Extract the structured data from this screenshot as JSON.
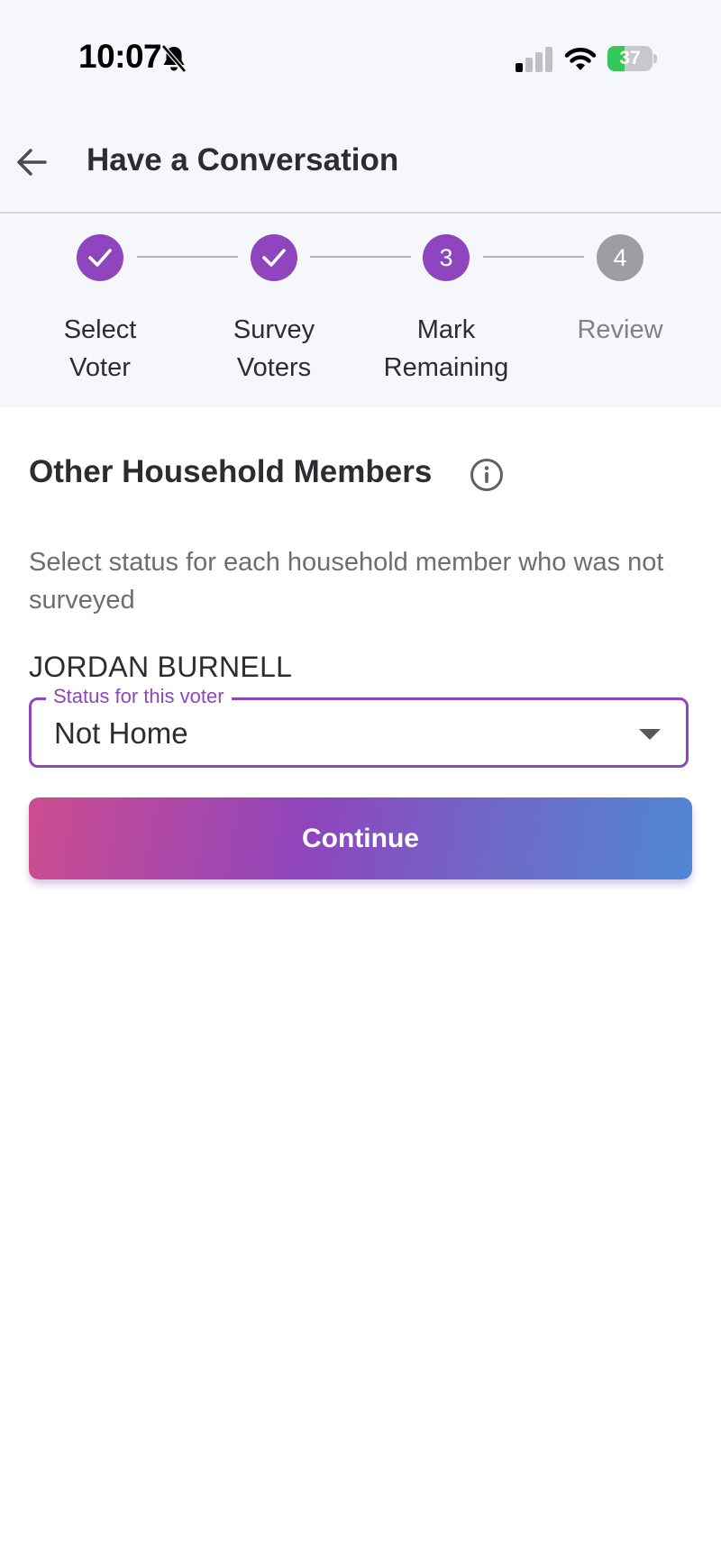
{
  "status_bar": {
    "time": "10:07",
    "battery_percent": "37",
    "battery_level": 0.37,
    "icons": [
      "bell-slash-icon",
      "cellular-signal-icon",
      "wifi-icon",
      "battery-charging-icon"
    ]
  },
  "header": {
    "title": "Have a Conversation",
    "back_icon": "arrow-left-icon"
  },
  "stepper": {
    "steps": [
      {
        "number": "1",
        "label": "Select\nVoter",
        "state": "complete"
      },
      {
        "number": "2",
        "label": "Survey\nVoters",
        "state": "complete"
      },
      {
        "number": "3",
        "label": "Mark\nRemaining",
        "state": "active"
      },
      {
        "number": "4",
        "label": "Review",
        "state": "upcoming"
      }
    ]
  },
  "main": {
    "section_title": "Other Household Members",
    "info_icon": "info-circle-icon",
    "subtitle": "Select status for each household member who was not surveyed",
    "voter": {
      "name": "JORDAN BURNELL",
      "status_label": "Status for this voter",
      "status_value": "Not Home"
    },
    "continue_label": "Continue"
  },
  "colors": {
    "accent": "#8f45bd",
    "gradient_start": "#cd4c8f",
    "gradient_end": "#4f87d4",
    "step_inactive": "#9d9ea2"
  }
}
